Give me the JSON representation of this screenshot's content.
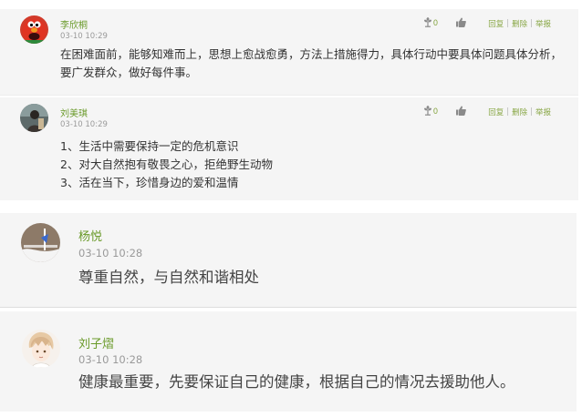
{
  "comments": [
    {
      "user": "李欣桐",
      "time": "03-10 10:29",
      "content": "在困难面前，能够知难而上，思想上愈战愈勇，方法上措施得力，具体行动中要具体问题具体分析，要广发群众，做好每件事。",
      "likes": "0",
      "avatar_icon": "elmo-avatar-icon",
      "actions": {
        "reply": "回复",
        "delete": "删除",
        "report": "举报"
      }
    },
    {
      "user": "刘美琪",
      "time": "03-10 10:29",
      "content_lines": [
        "1、生活中需要保持一定的危机意识",
        "2、对大自然抱有敬畏之心，拒绝野生动物",
        "3、活在当下，珍惜身边的爱和温情"
      ],
      "likes": "0",
      "avatar_icon": "photo-avatar-icon",
      "actions": {
        "reply": "回复",
        "delete": "删除",
        "report": "举报"
      }
    },
    {
      "user": "杨悦",
      "time": "03-10 10:28",
      "content": "尊重自然，与自然和谐相处",
      "avatar_icon": "drawing-avatar-icon"
    },
    {
      "user": "刘子熠",
      "time": "03-10 10:28",
      "content": "健康最重要，先要保证自己的健康，根据自己的情况去援助他人。",
      "avatar_icon": "anime-boy-avatar-icon"
    }
  ],
  "colors": {
    "username": "#6a9a2a",
    "link": "#8aa848",
    "timestamp": "#9a9a9a",
    "text": "#333333",
    "background": "#f5f5f5"
  }
}
